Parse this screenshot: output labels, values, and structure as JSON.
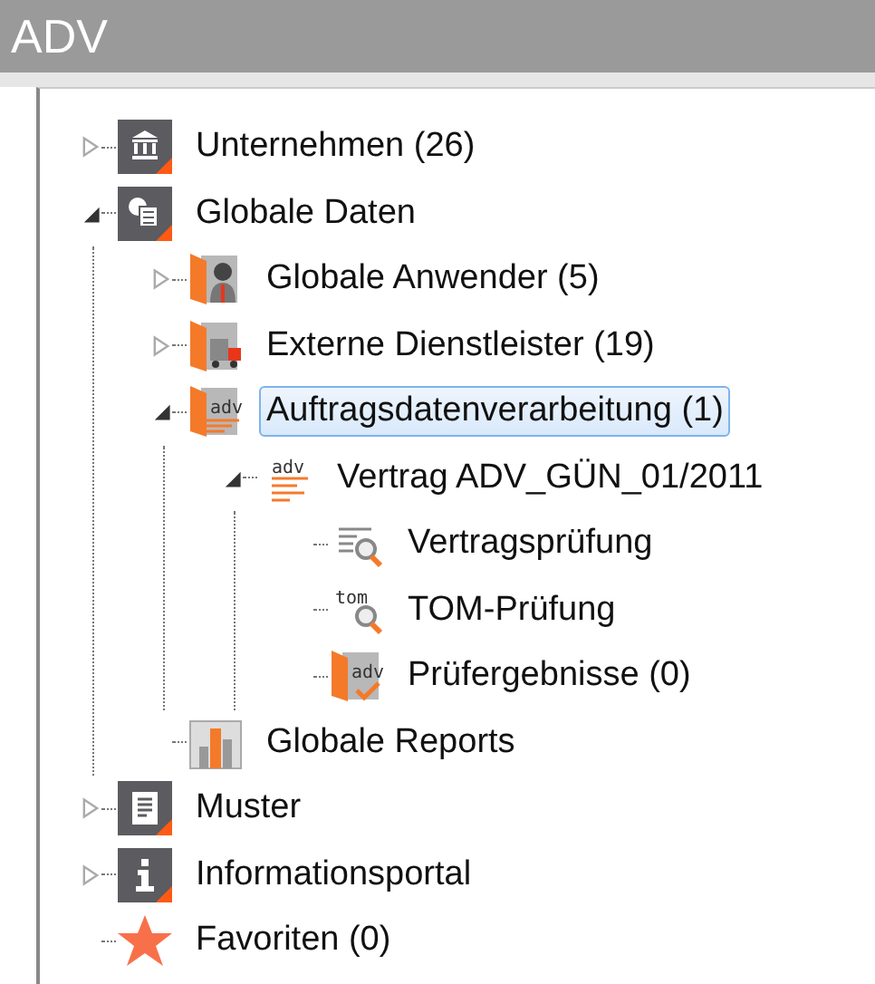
{
  "header": {
    "title": "ADV"
  },
  "tree": [
    {
      "label": "Unternehmen (26)",
      "kind": "building",
      "expanded": false,
      "selected": false
    },
    {
      "label": "Globale Daten",
      "kind": "data",
      "expanded": true,
      "selected": false,
      "children": [
        {
          "label": "Globale Anwender (5)",
          "kind": "user",
          "expanded": false,
          "selected": false
        },
        {
          "label": "Externe Dienstleister (19)",
          "kind": "truck",
          "expanded": false,
          "selected": false
        },
        {
          "label": "Auftragsdatenverarbeitung (1)",
          "kind": "adv",
          "icon_text": "adv",
          "expanded": true,
          "selected": true,
          "children": [
            {
              "label": "Vertrag ADV_GÜN_01/2011",
              "kind": "contract",
              "icon_text": "adv",
              "expanded": true,
              "selected": false,
              "children": [
                {
                  "label": "Vertragsprüfung",
                  "kind": "review",
                  "selected": false
                },
                {
                  "label": "TOM-Prüfung",
                  "kind": "tom",
                  "icon_text": "tom",
                  "selected": false
                },
                {
                  "label": "Prüfergebnisse (0)",
                  "kind": "result",
                  "icon_text": "adv",
                  "selected": false
                }
              ]
            }
          ]
        },
        {
          "label": "Globale Reports",
          "kind": "report",
          "selected": false
        }
      ]
    },
    {
      "label": "Muster",
      "kind": "doc",
      "expanded": false,
      "selected": false
    },
    {
      "label": "Informationsportal",
      "kind": "info",
      "expanded": false,
      "selected": false
    },
    {
      "label": "Favoriten (0)",
      "kind": "star",
      "selected": false
    }
  ]
}
